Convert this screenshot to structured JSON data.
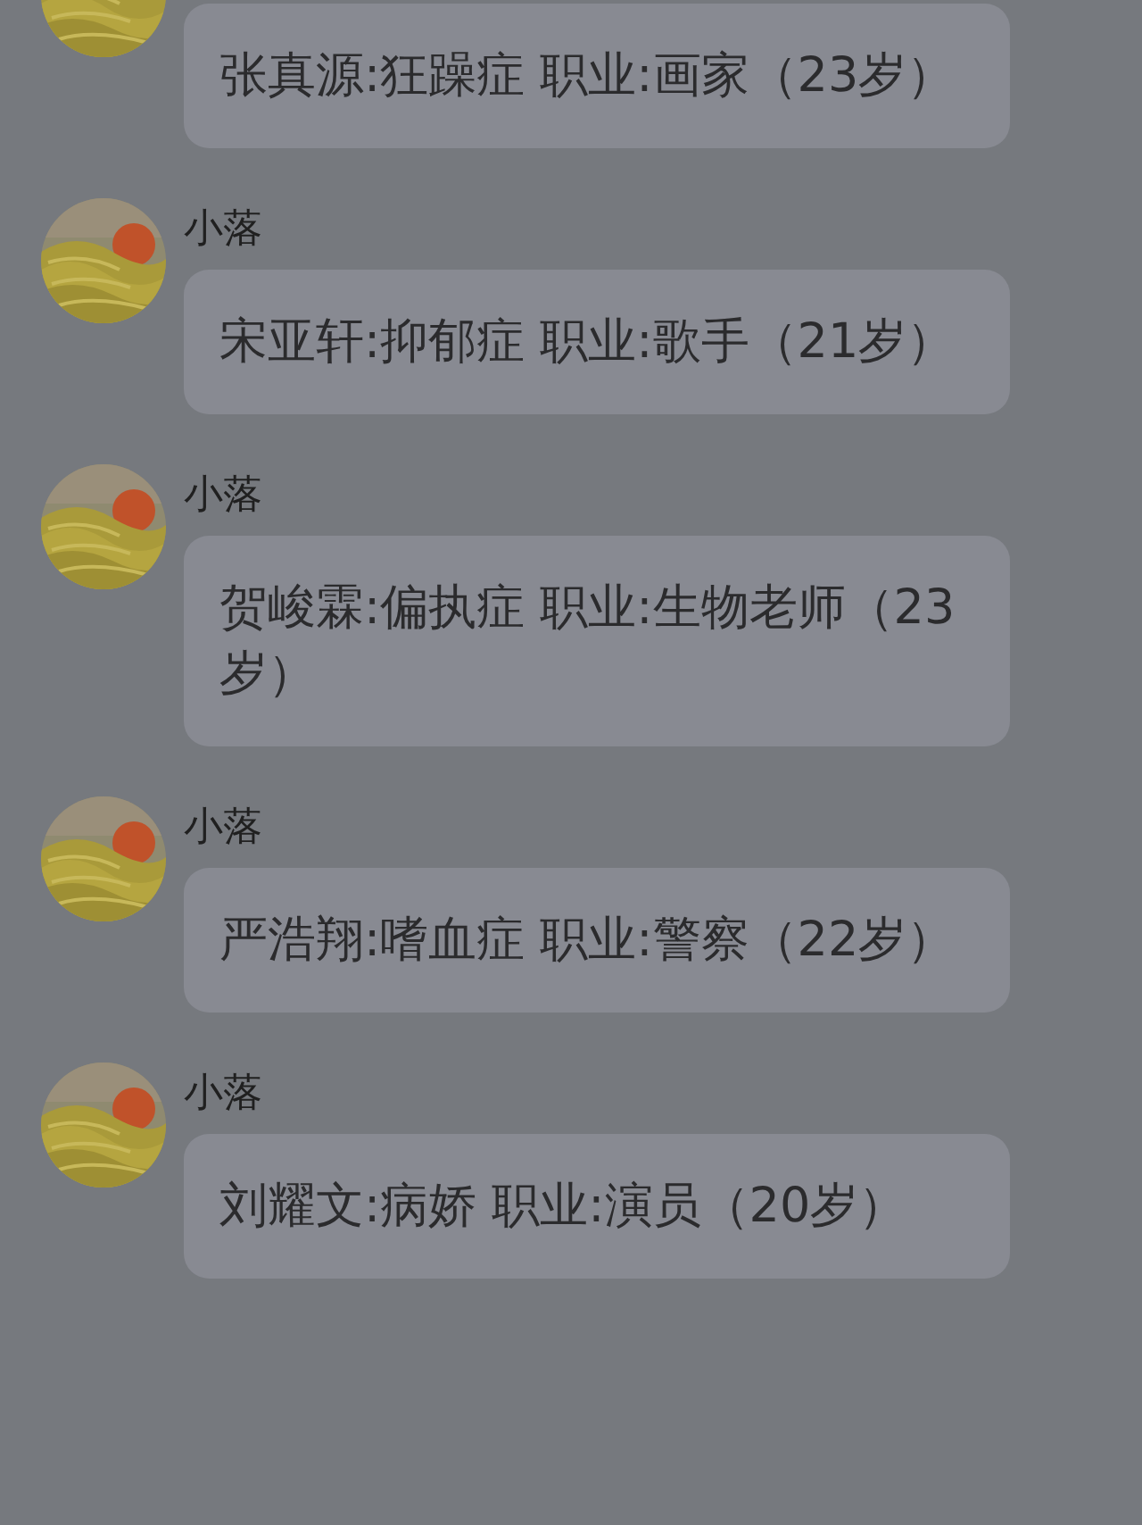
{
  "messages": [
    {
      "text": "张真源:狂躁症 职业:画家（23岁）"
    },
    {
      "sender": "小落",
      "text": "宋亚轩:抑郁症 职业:歌手（21岁）"
    },
    {
      "sender": "小落",
      "text": "贺峻霖:偏执症 职业:生物老师（23岁）"
    },
    {
      "sender": "小落",
      "text": "严浩翔:嗜血症 职业:警察（22岁）"
    },
    {
      "sender": "小落",
      "text": "刘耀文:病娇 职业:演员（20岁）"
    }
  ]
}
